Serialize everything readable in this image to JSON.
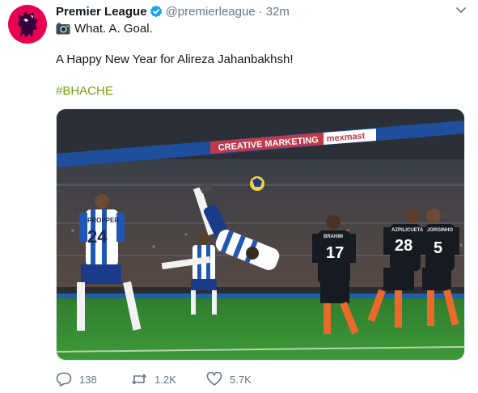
{
  "account": {
    "name": "Premier League",
    "handle": "@premierleague",
    "separator": "·",
    "time": "32m",
    "verified": true,
    "avatar_icon": "premier-league-lion-logo",
    "avatar_color": "#e90052"
  },
  "tweet": {
    "line1_icon": "camera-icon",
    "line1": "What. A. Goal.",
    "line2": "A Happy New Year for Alireza Jahanbakhsh!",
    "hashtag": "#BHACHE",
    "hashtag_color": "#76a00a"
  },
  "photo": {
    "stadium_signs": [
      "CREATIVE MARKETING",
      "mexmast"
    ],
    "players": [
      {
        "name": "PROPPER",
        "number": "24"
      },
      {
        "name": "BRAHIM",
        "number": "17"
      },
      {
        "name": "AZPILICUETA",
        "number": "28"
      },
      {
        "name": "JORGINHO",
        "number": "5"
      }
    ]
  },
  "actions": {
    "reply": {
      "icon": "reply-icon",
      "count": "138"
    },
    "retweet": {
      "icon": "retweet-icon",
      "count": "1.2K"
    },
    "like": {
      "icon": "heart-icon",
      "count": "5.7K"
    }
  },
  "colors": {
    "text": "#14171a",
    "secondary": "#657786",
    "verified": "#1da1f2"
  }
}
